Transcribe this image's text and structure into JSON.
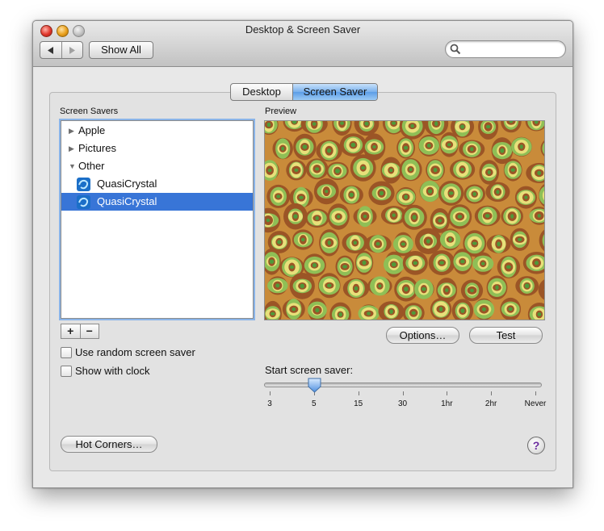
{
  "window": {
    "title": "Desktop & Screen Saver"
  },
  "toolbar": {
    "show_all_label": "Show All",
    "back_icon": "back-arrow-icon",
    "forward_icon": "forward-arrow-icon"
  },
  "search": {
    "value": "",
    "placeholder": ""
  },
  "tabs": [
    {
      "label": "Desktop",
      "selected": false
    },
    {
      "label": "Screen Saver",
      "selected": true
    }
  ],
  "screen_savers": {
    "header": "Screen Savers",
    "items": [
      {
        "label": "Apple",
        "type": "group",
        "expanded": false
      },
      {
        "label": "Pictures",
        "type": "group",
        "expanded": false
      },
      {
        "label": "Other",
        "type": "group",
        "expanded": true
      },
      {
        "label": "QuasiCrystal",
        "type": "item",
        "selected": false
      },
      {
        "label": "QuasiCrystal",
        "type": "item",
        "selected": true
      }
    ]
  },
  "list_controls": {
    "plus": "+",
    "minus": "−"
  },
  "preview": {
    "header": "Preview",
    "colors": [
      "#9b5526",
      "#c98b3a",
      "#e8e07a",
      "#8fbf56",
      "#4f9a3a"
    ]
  },
  "buttons": {
    "options": "Options…",
    "test": "Test",
    "hot_corners": "Hot Corners…",
    "help": "?"
  },
  "options": {
    "random": {
      "label": "Use random screen saver",
      "checked": false
    },
    "clock": {
      "label": "Show with clock",
      "checked": false
    }
  },
  "start_slider": {
    "label": "Start screen saver:",
    "ticks": [
      "3",
      "5",
      "15",
      "30",
      "1hr",
      "2hr",
      "Never"
    ],
    "selected": "5"
  }
}
